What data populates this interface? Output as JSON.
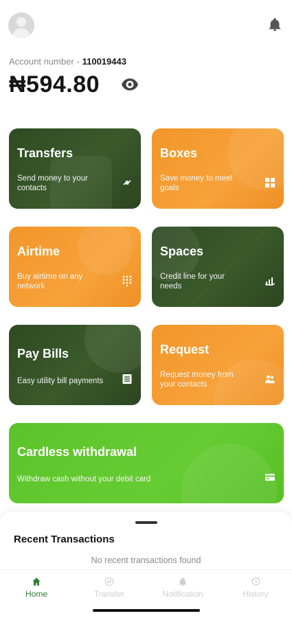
{
  "header": {
    "account_label": "Account number -",
    "account_number": "110019443",
    "balance": "₦594.80",
    "avatar_icon": "user-avatar-icon",
    "notification_icon": "bell-icon",
    "visibility_icon": "eye-icon"
  },
  "cards": {
    "transfers": {
      "title": "Transfers",
      "desc": "Send money to your contacts",
      "icon": "transfer-arrows-icon"
    },
    "boxes": {
      "title": "Boxes",
      "desc": "Save money to meet goals",
      "icon": "grid-icon"
    },
    "airtime": {
      "title": "Airtime",
      "desc": "Buy airtime on any network",
      "icon": "dialpad-icon"
    },
    "spaces": {
      "title": "Spaces",
      "desc": "Credit line for your needs",
      "icon": "chart-hand-icon"
    },
    "pay_bills": {
      "title": "Pay Bills",
      "desc": "Easy utility bill payments",
      "icon": "receipt-icon"
    },
    "request": {
      "title": "Request",
      "desc": "Request money from your contacts",
      "icon": "people-icon"
    },
    "cardless": {
      "title": "Cardless withdrawal",
      "desc": "Withdraw cash without your debit card",
      "icon": "card-icon"
    }
  },
  "recent": {
    "title": "Recent Transactions",
    "empty": "No recent transactions found"
  },
  "nav": {
    "home": "Home",
    "transfer": "Transfer",
    "notification": "Notification",
    "history": "History"
  },
  "colors": {
    "dark_green": "#3a5a2b",
    "orange": "#f7a23a",
    "lime": "#66cc33",
    "active_nav": "#2e7d32"
  }
}
